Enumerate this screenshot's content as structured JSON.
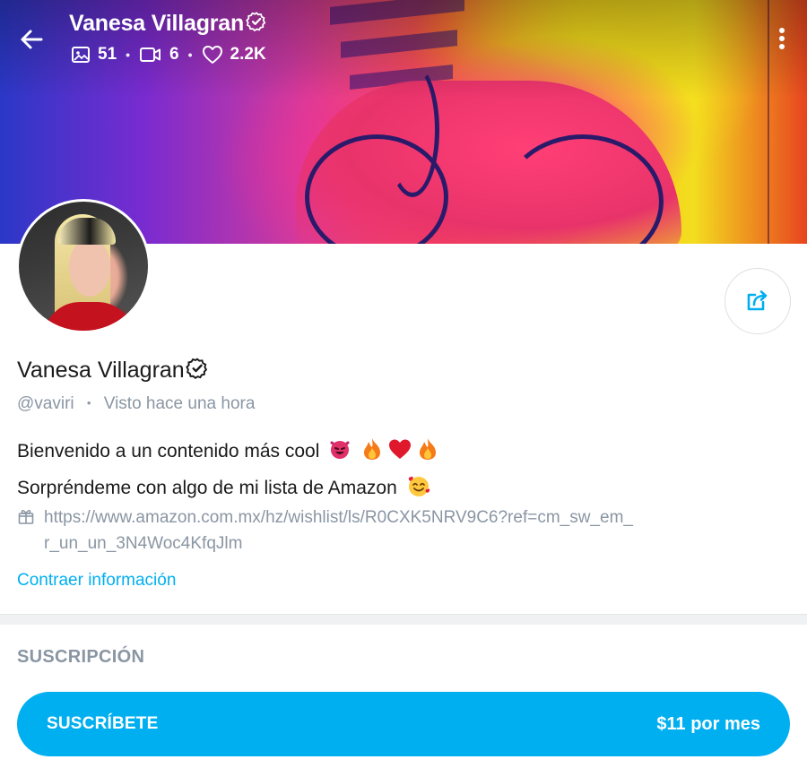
{
  "header": {
    "title": "Vanesa Villagran",
    "stats": {
      "photos": "51",
      "videos": "6",
      "likes": "2.2K"
    }
  },
  "profile": {
    "name": "Vanesa Villagran",
    "handle": "@vaviri",
    "status": "Visto hace una hora",
    "bio_line1": "Bienvenido a un contenido más cool",
    "bio_line2": "Sorpréndeme con algo de mi lista de Amazon",
    "link": "https://www.amazon.com.mx/hz/wishlist/ls/R0CXK5NRV9C6?ref=cm_sw_em_r_un_un_3N4Woc4KfqJlm",
    "collapse_label": "Contraer información"
  },
  "subscription": {
    "section_title": "SUSCRIPCIÓN",
    "button_label": "SUSCRÍBETE",
    "price": "$11 por mes"
  },
  "colors": {
    "accent": "#00aff0",
    "muted": "#8a96a3",
    "text": "#1a1a1a"
  },
  "icons": [
    "back-arrow-icon",
    "verified-badge-icon",
    "image-icon",
    "video-icon",
    "heart-icon",
    "more-vertical-icon",
    "share-icon",
    "gift-icon"
  ]
}
